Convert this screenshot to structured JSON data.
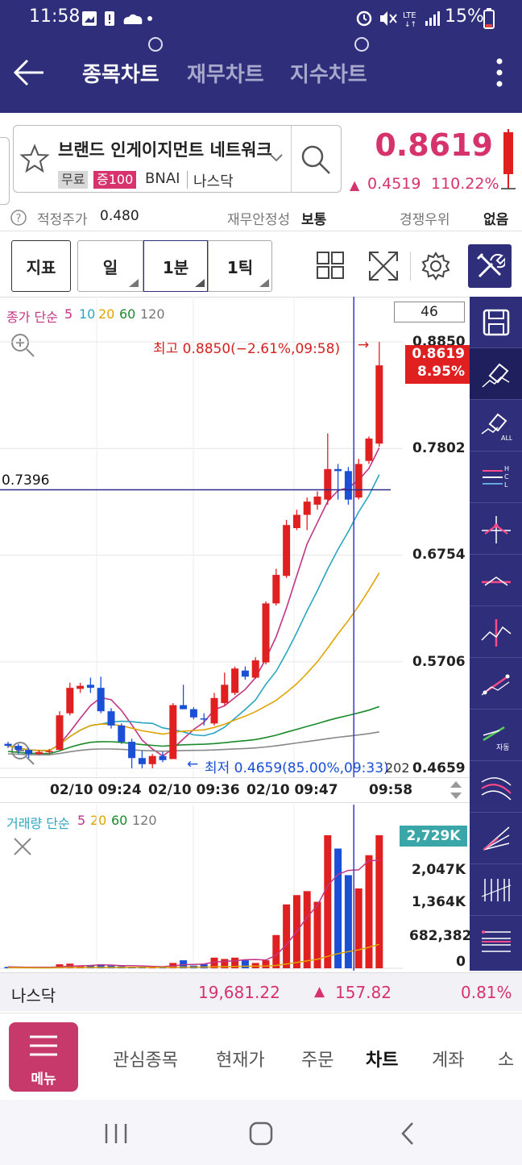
{
  "status_bar": {
    "time": "11:58",
    "network": "LTE",
    "battery": "15%"
  },
  "app_header": {
    "tabs": [
      {
        "label": "종목차트",
        "active": true
      },
      {
        "label": "재무차트",
        "active": false
      },
      {
        "label": "지수차트",
        "active": false
      }
    ]
  },
  "stock": {
    "name": "브랜드 인게이지먼트 네트워크",
    "tag_free": "무료",
    "tag_margin": "증100",
    "ticker": "BNAI",
    "market": "나스닥",
    "price": "0.8619",
    "change": "0.4519",
    "change_pct": "110.22%"
  },
  "info_row": {
    "fair_price_label": "적정주가",
    "fair_price_value": "0.480",
    "stability_label": "재무안정성",
    "stability_value": "보통",
    "competition_label": "경쟁우위",
    "competition_value": "없음"
  },
  "toolbar": {
    "indicator": "지표",
    "day": "일",
    "min": "1분",
    "tick": "1틱",
    "count_value": "46"
  },
  "price_chart": {
    "legend_prefix": "종가 단순",
    "ma_periods": [
      "5",
      "10",
      "20",
      "60",
      "120"
    ],
    "high_label": "최고 0.8850(−2.61%,09:58)",
    "low_label": "최저 0.4659(85.00%,09:33)",
    "cursor_price_label": "0.7396",
    "current_price_tag": "0.8619",
    "current_pct_tag": "8.95%",
    "y_ticks": [
      "0.8850",
      "0.7802",
      "0.6754",
      "0.5706",
      "0.4659"
    ],
    "x_ticks": [
      "02/10 09:24",
      "02/10 09:36",
      "02/10 09:47",
      "09:58"
    ],
    "x_cursor_partial": "202"
  },
  "volume_chart": {
    "legend_prefix": "거래량 단순",
    "ma_periods": [
      "5",
      "20",
      "60",
      "120"
    ],
    "current_tag": "2,729K",
    "y_ticks": [
      "2,047K",
      "1,364K",
      "682,382",
      "0"
    ]
  },
  "index_bar": {
    "name": "나스닥",
    "value": "19,681.22",
    "change": "157.82",
    "pct": "0.81%"
  },
  "bottom_nav": {
    "menu_label": "메뉴",
    "items": [
      "관심종목",
      "현재가",
      "주문",
      "차트",
      "계좌",
      "소"
    ],
    "active": "차트"
  },
  "colors": {
    "header": "#2e2e7a",
    "up": "#e02020",
    "down": "#1a4fd6",
    "accent_pink": "#d6336c"
  },
  "chart_data": {
    "type": "candlestick",
    "interval": "1분",
    "ylim": [
      0.4659,
      0.885
    ],
    "candles": [
      {
        "o": 0.49,
        "h": 0.492,
        "l": 0.486,
        "c": 0.488
      },
      {
        "o": 0.488,
        "h": 0.49,
        "l": 0.48,
        "c": 0.484
      },
      {
        "o": 0.484,
        "h": 0.486,
        "l": 0.476,
        "c": 0.48
      },
      {
        "o": 0.48,
        "h": 0.484,
        "l": 0.479,
        "c": 0.482
      },
      {
        "o": 0.482,
        "h": 0.485,
        "l": 0.48,
        "c": 0.483
      },
      {
        "o": 0.484,
        "h": 0.522,
        "l": 0.484,
        "c": 0.518
      },
      {
        "o": 0.52,
        "h": 0.55,
        "l": 0.518,
        "c": 0.545
      },
      {
        "o": 0.544,
        "h": 0.55,
        "l": 0.54,
        "c": 0.547
      },
      {
        "o": 0.548,
        "h": 0.555,
        "l": 0.54,
        "c": 0.545
      },
      {
        "o": 0.545,
        "h": 0.556,
        "l": 0.52,
        "c": 0.522
      },
      {
        "o": 0.522,
        "h": 0.525,
        "l": 0.505,
        "c": 0.508
      },
      {
        "o": 0.508,
        "h": 0.51,
        "l": 0.49,
        "c": 0.492
      },
      {
        "o": 0.492,
        "h": 0.495,
        "l": 0.466,
        "c": 0.476
      },
      {
        "o": 0.476,
        "h": 0.483,
        "l": 0.466,
        "c": 0.47
      },
      {
        "o": 0.47,
        "h": 0.48,
        "l": 0.466,
        "c": 0.478
      },
      {
        "o": 0.478,
        "h": 0.482,
        "l": 0.472,
        "c": 0.474
      },
      {
        "o": 0.475,
        "h": 0.53,
        "l": 0.475,
        "c": 0.528
      },
      {
        "o": 0.528,
        "h": 0.548,
        "l": 0.526,
        "c": 0.524
      },
      {
        "o": 0.524,
        "h": 0.526,
        "l": 0.514,
        "c": 0.516
      },
      {
        "o": 0.515,
        "h": 0.52,
        "l": 0.508,
        "c": 0.514
      },
      {
        "o": 0.51,
        "h": 0.54,
        "l": 0.508,
        "c": 0.535
      },
      {
        "o": 0.53,
        "h": 0.56,
        "l": 0.528,
        "c": 0.548
      },
      {
        "o": 0.54,
        "h": 0.566,
        "l": 0.538,
        "c": 0.564
      },
      {
        "o": 0.562,
        "h": 0.566,
        "l": 0.553,
        "c": 0.556
      },
      {
        "o": 0.555,
        "h": 0.575,
        "l": 0.554,
        "c": 0.572
      },
      {
        "o": 0.57,
        "h": 0.63,
        "l": 0.568,
        "c": 0.628
      },
      {
        "o": 0.628,
        "h": 0.662,
        "l": 0.626,
        "c": 0.656
      },
      {
        "o": 0.655,
        "h": 0.71,
        "l": 0.653,
        "c": 0.705
      },
      {
        "o": 0.702,
        "h": 0.72,
        "l": 0.7,
        "c": 0.715
      },
      {
        "o": 0.715,
        "h": 0.732,
        "l": 0.7,
        "c": 0.728
      },
      {
        "o": 0.725,
        "h": 0.738,
        "l": 0.72,
        "c": 0.733
      },
      {
        "o": 0.73,
        "h": 0.795,
        "l": 0.725,
        "c": 0.76
      },
      {
        "o": 0.76,
        "h": 0.765,
        "l": 0.73,
        "c": 0.758
      },
      {
        "o": 0.758,
        "h": 0.762,
        "l": 0.725,
        "c": 0.73
      },
      {
        "o": 0.732,
        "h": 0.77,
        "l": 0.73,
        "c": 0.765
      },
      {
        "o": 0.768,
        "h": 0.792,
        "l": 0.765,
        "c": 0.79
      },
      {
        "o": 0.785,
        "h": 0.885,
        "l": 0.782,
        "c": 0.8619
      }
    ],
    "volume": [
      0.01,
      0.008,
      0.006,
      0.005,
      0.006,
      0.03,
      0.035,
      0.015,
      0.02,
      0.03,
      0.02,
      0.015,
      0.012,
      0.01,
      0.015,
      0.01,
      0.04,
      0.06,
      0.02,
      0.03,
      0.08,
      0.07,
      0.08,
      0.06,
      0.04,
      0.06,
      0.25,
      0.48,
      0.55,
      0.58,
      0.5,
      1.0,
      0.9,
      0.7,
      0.6,
      0.85,
      1.0
    ]
  }
}
